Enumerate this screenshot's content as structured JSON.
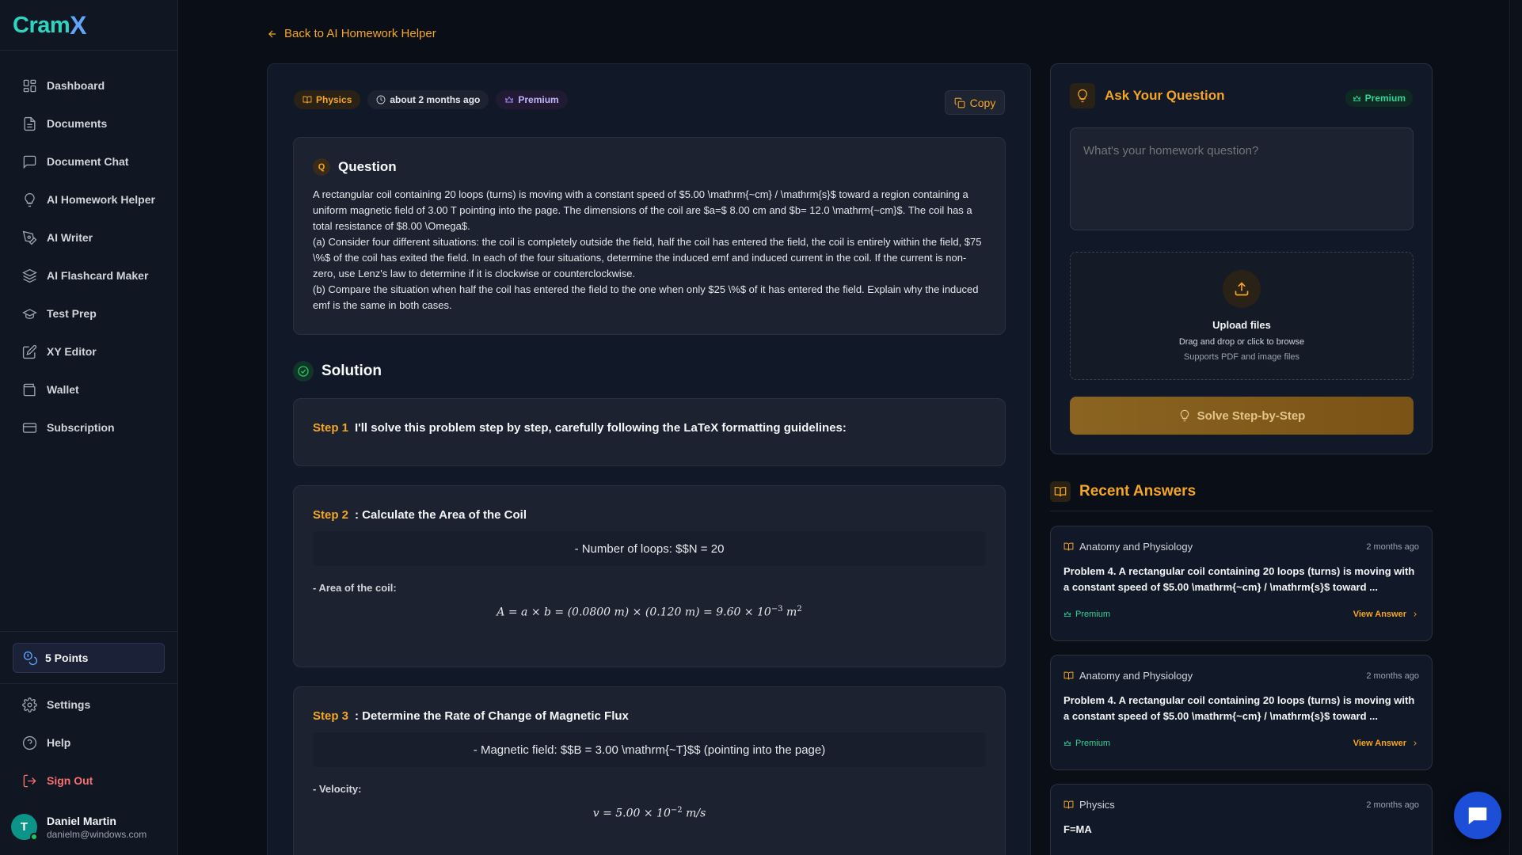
{
  "app": {
    "logo_main": "Cram",
    "logo_accent": "X"
  },
  "sidebar": {
    "items": [
      {
        "label": "Dashboard",
        "icon": "dashboard-icon"
      },
      {
        "label": "Documents",
        "icon": "document-icon"
      },
      {
        "label": "Document Chat",
        "icon": "chat-icon"
      },
      {
        "label": "AI Homework Helper",
        "icon": "bulb-icon"
      },
      {
        "label": "AI Writer",
        "icon": "pen-icon"
      },
      {
        "label": "AI Flashcard Maker",
        "icon": "layers-icon"
      },
      {
        "label": "Test Prep",
        "icon": "graduation-cap-icon"
      },
      {
        "label": "XY Editor",
        "icon": "edit-icon"
      },
      {
        "label": "Wallet",
        "icon": "wallet-icon"
      },
      {
        "label": "Subscription",
        "icon": "card-icon"
      }
    ],
    "points": "5 Points",
    "bottom": [
      {
        "label": "Settings",
        "icon": "gear-icon"
      },
      {
        "label": "Help",
        "icon": "help-icon"
      },
      {
        "label": "Sign Out",
        "icon": "sign-out-icon"
      }
    ],
    "user": {
      "initial": "T",
      "name": "Daniel Martin",
      "email": "danielm@windows.com"
    }
  },
  "back_link": "Back to AI Homework Helper",
  "question_view": {
    "tags": {
      "subject": "Physics",
      "time": "about 2 months ago",
      "premium": "Premium"
    },
    "copy_label": "Copy",
    "question": {
      "badge": "Q",
      "title": "Question",
      "lines": [
        "A rectangular coil containing 20 loops (turns) is moving with a constant speed of $5.00 \\mathrm{~cm} / \\mathrm{s}$ toward a region containing a uniform magnetic field of 3.00 T pointing into the page. The dimensions of the coil are $a=$ 8.00 cm and $b= 12.0 \\mathrm{~cm}$. The coil has a total resistance of $8.00 \\Omega$.",
        "(a) Consider four different situations: the coil is completely outside the field, half the coil has entered the field, the coil is entirely within the field, $75 \\%$ of the coil has exited the field. In each of the four situations, determine the induced emf and induced current in the coil. If the current is non-zero, use Lenz's law to determine if it is clockwise or counterclockwise.",
        "(b) Compare the situation when half the coil has entered the field to the one when only $25 \\%$ of it has entered the field. Explain why the induced emf is the same in both cases."
      ]
    },
    "solution": {
      "title": "Solution",
      "steps": [
        {
          "num": "Step 1",
          "title": "I'll solve this problem step by step, carefully following the LaTeX formatting guidelines:"
        },
        {
          "num": "Step 2",
          "title": ": Calculate the Area of the Coil",
          "block": "- Number of loops: $$N = 20",
          "sub": "- Area of the coil:",
          "formula": "A = a × b = (0.0800 m) × (0.120 m) = 9.60 × 10",
          "formula_exp": "−3",
          "formula_tail": " m",
          "formula_tail_exp": "2"
        },
        {
          "num": "Step 3",
          "title": ": Determine the Rate of Change of Magnetic Flux",
          "block": "- Magnetic field: $$B = 3.00 \\mathrm{~T}$$ (pointing into the page)",
          "sub": "- Velocity:",
          "formula": "v = 5.00 × 10",
          "formula_exp": "−2",
          "formula_tail": " m/s"
        }
      ]
    }
  },
  "ask": {
    "title": "Ask Your Question",
    "premium": "Premium",
    "placeholder": "What's your homework question?",
    "upload_title": "Upload files",
    "upload_sub": "Drag and drop or click to browse",
    "upload_sub2": "Supports PDF and image files",
    "solve_label": "Solve Step-by-Step"
  },
  "recent": {
    "title": "Recent Answers",
    "items": [
      {
        "subject": "Anatomy and Physiology",
        "time": "2 months ago",
        "text": "Problem 4. A rectangular coil containing 20 loops (turns) is moving with a constant speed of $5.00 \\mathrm{~cm} / \\mathrm{s}$ toward ...",
        "premium": "Premium",
        "view": "View Answer"
      },
      {
        "subject": "Anatomy and Physiology",
        "time": "2 months ago",
        "text": "Problem 4. A rectangular coil containing 20 loops (turns) is moving with a constant speed of $5.00 \\mathrm{~cm} / \\mathrm{s}$ toward ...",
        "premium": "Premium",
        "view": "View Answer"
      },
      {
        "subject": "Physics",
        "time": "2 months ago",
        "text": "F=MA"
      }
    ]
  },
  "colors": {
    "accent": "#f5a623",
    "bg": "#0a0e16",
    "sidebar": "#111722",
    "card": "#1c2230",
    "premium_green": "#34d399"
  }
}
